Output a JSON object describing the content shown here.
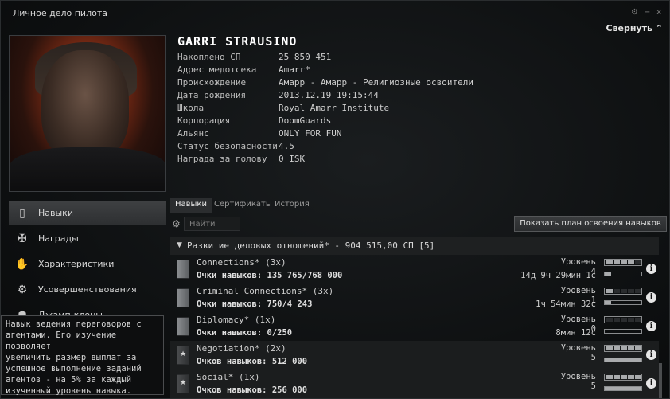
{
  "window": {
    "title": "Личное дело пилота",
    "collapse_label": "Свернуть",
    "controls": [
      "⚙",
      "−",
      "×"
    ]
  },
  "character": {
    "name": "GARRI STRAUSINO",
    "fields": [
      {
        "label": "Накоплено СП",
        "value": "25 850 451"
      },
      {
        "label": "Адрес медотсека",
        "value": "Amarr*"
      },
      {
        "label": "Происхождение",
        "value": "Амарр - Амарр - Религиозные освоители"
      },
      {
        "label": "Дата рождения",
        "value": "2013.12.19 19:15:44"
      },
      {
        "label": "Школа",
        "value": "Royal Amarr Institute"
      },
      {
        "label": "Корпорация",
        "value": "DoomGuards"
      },
      {
        "label": "Альянс",
        "value": "ONLY FOR FUN"
      },
      {
        "label": "Статус безопасности",
        "value": "4.5"
      },
      {
        "label": "Награда за голову",
        "value": "0 ISK"
      }
    ]
  },
  "sidebar": {
    "items": [
      {
        "label": "Навыки",
        "icon": "skillbook-icon"
      },
      {
        "label": "Награды",
        "icon": "medal-icon"
      },
      {
        "label": "Характеристики",
        "icon": "attributes-icon"
      },
      {
        "label": "Усовершенствования",
        "icon": "implants-icon"
      },
      {
        "label": "Джамп-клоны",
        "icon": "clone-icon"
      }
    ]
  },
  "tooltip": {
    "lines": [
      "Навык ведения переговоров с",
      "агентами. Его изучение позволяет",
      "увеличить размер выплат за",
      "успешное выполнение заданий",
      "агентов - на 5% за каждый",
      "изученный уровень навыка."
    ]
  },
  "tabs": [
    "Навыки",
    "Сертификаты",
    "История"
  ],
  "search": {
    "placeholder": "Найти"
  },
  "plan_button": "Показать план освоения навыков",
  "group": {
    "label": "Развитие деловых отношений* - 904 515,00 СП [5]"
  },
  "skills": [
    {
      "name": "Connections* (3x)",
      "points": "Очки навыков: 135 765/768 000",
      "level": "Уровень 4",
      "time": "14д 9ч 29мин 1с",
      "level_value": 4,
      "progress": 0.18,
      "trained": false
    },
    {
      "name": "Criminal Connections* (3x)",
      "points": "Очки навыков: 750/4 243",
      "level": "Уровень 1",
      "time": "1ч 54мин 32с",
      "level_value": 1,
      "progress": 0.18,
      "trained": false
    },
    {
      "name": "Diplomacy* (1x)",
      "points": "Очки навыков: 0/250",
      "level": "Уровень 0",
      "time": "8мин 12с",
      "level_value": 0,
      "progress": 0.0,
      "trained": false
    },
    {
      "name": "Negotiation* (2x)",
      "points": "Очков навыков: 512 000",
      "level": "Уровень 5",
      "time": "",
      "level_value": 5,
      "progress": 1.0,
      "trained": true
    },
    {
      "name": "Social* (1x)",
      "points": "Очков навыков: 256 000",
      "level": "Уровень 5",
      "time": "",
      "level_value": 5,
      "progress": 1.0,
      "trained": true
    }
  ],
  "colors": {
    "background": "#0b0d0e",
    "text": "#cfcfcf",
    "accent": "#a9abad"
  }
}
